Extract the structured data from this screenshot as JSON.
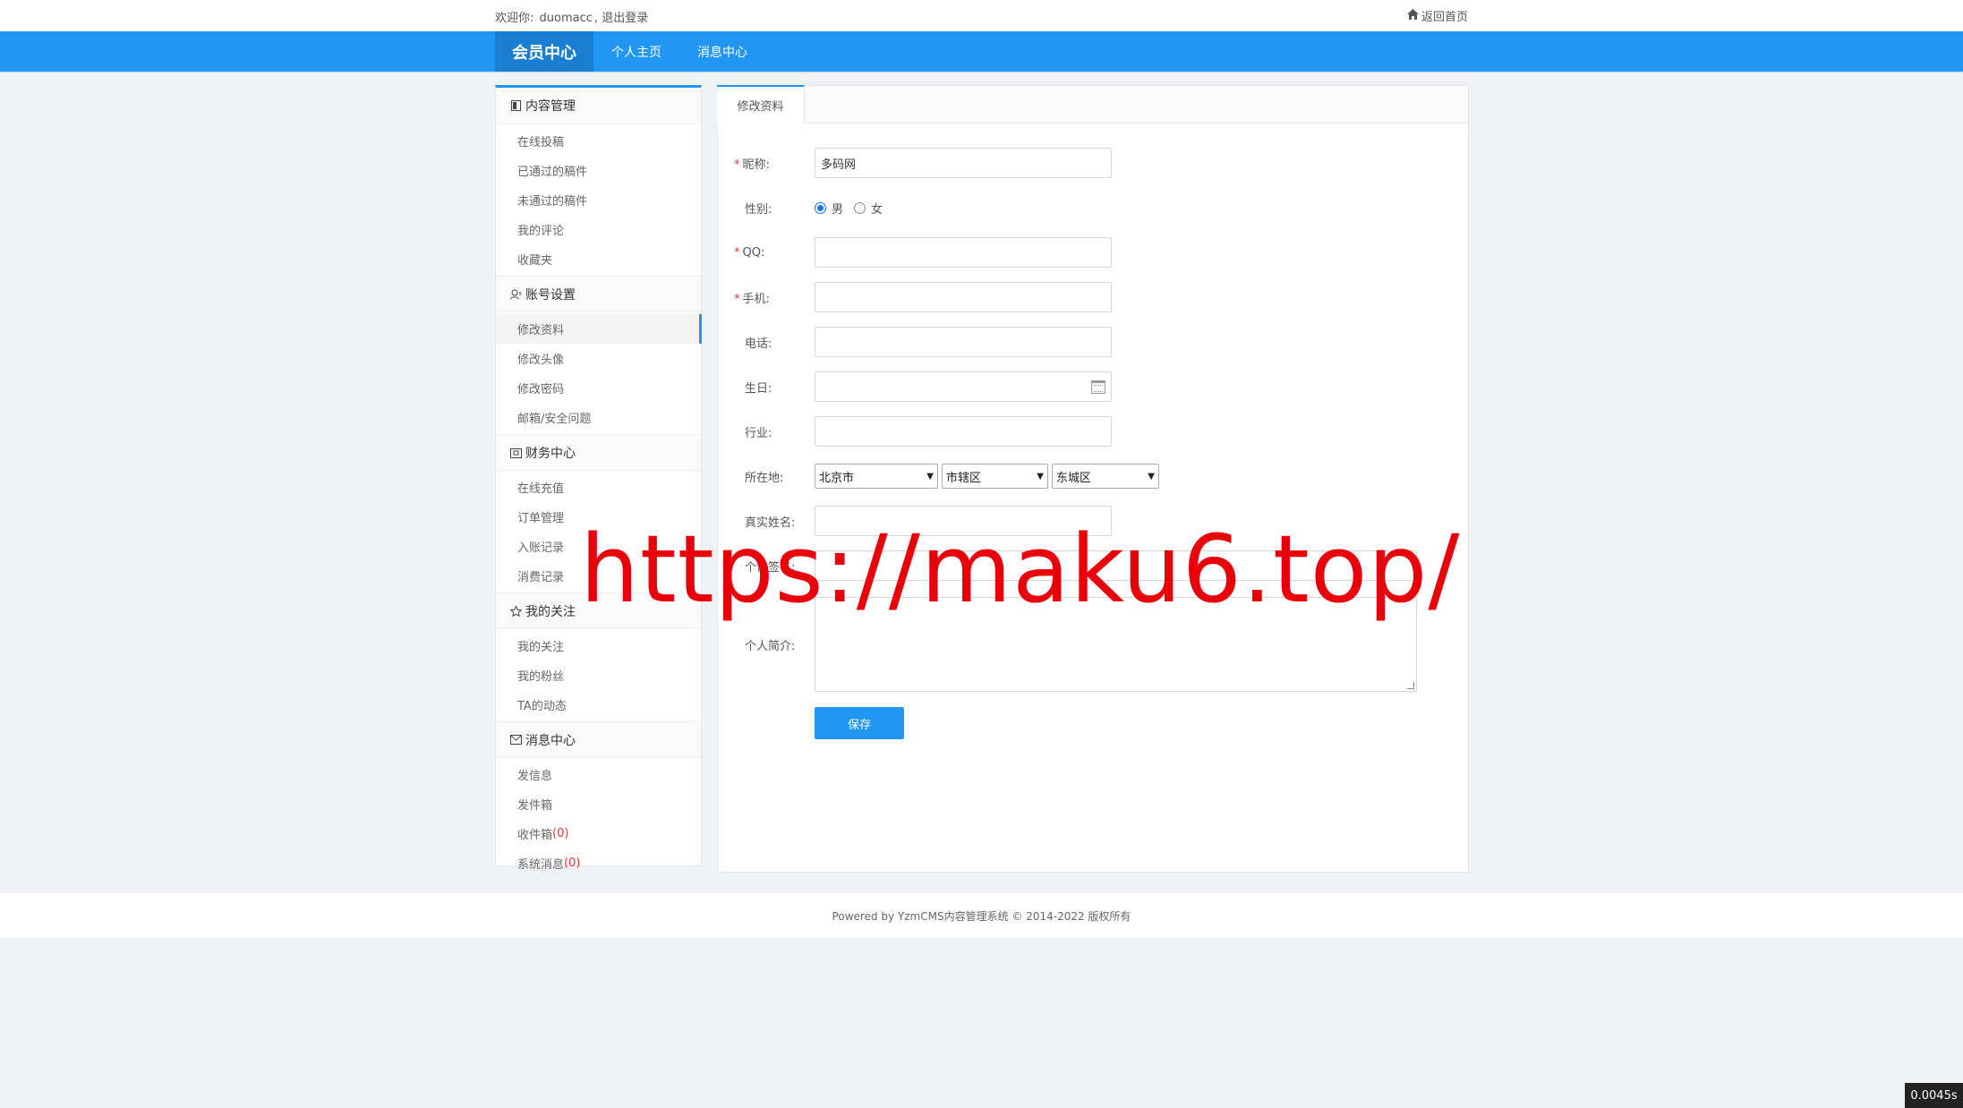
{
  "topbar": {
    "welcome_prefix": "欢迎你:",
    "username": "duomacc",
    "separator": ",",
    "logout": "退出登录",
    "home_link": "返回首页",
    "home_icon": "home-icon"
  },
  "navbar": {
    "brand": "会员中心",
    "items": [
      {
        "label": "个人主页"
      },
      {
        "label": "消息中心"
      }
    ]
  },
  "sidebar": {
    "groups": [
      {
        "title": "内容管理",
        "icon": "document-icon",
        "items": [
          "在线投稿",
          "已通过的稿件",
          "未通过的稿件",
          "我的评论",
          "收藏夹"
        ]
      },
      {
        "title": "账号设置",
        "icon": "user-icon",
        "items": [
          "修改资料",
          "修改头像",
          "修改密码",
          "邮箱/安全问题"
        ]
      },
      {
        "title": "财务中心",
        "icon": "wallet-icon",
        "items": [
          "在线充值",
          "订单管理",
          "入账记录",
          "消费记录"
        ]
      },
      {
        "title": "我的关注",
        "icon": "star-icon",
        "items": [
          "我的关注",
          "我的粉丝",
          "TA的动态"
        ]
      },
      {
        "title": "消息中心",
        "icon": "mail-icon",
        "items": [
          "发信息",
          "发件箱",
          "收件箱",
          "系统消息"
        ]
      }
    ],
    "active_item": "修改资料",
    "inbox_count": "(0)",
    "system_count": "(0)"
  },
  "main": {
    "tab": "修改资料",
    "fields": {
      "nickname": {
        "label": "昵称:",
        "value": "多码网",
        "required": true
      },
      "gender": {
        "label": "性别:",
        "options": [
          "男",
          "女"
        ],
        "selected": "男"
      },
      "qq": {
        "label": "QQ:",
        "value": "",
        "required": true
      },
      "mobile": {
        "label": "手机:",
        "value": "",
        "required": true
      },
      "phone": {
        "label": "电话:",
        "value": ""
      },
      "birthday": {
        "label": "生日:",
        "value": ""
      },
      "industry": {
        "label": "行业:",
        "value": ""
      },
      "location": {
        "label": "所在地:",
        "province": "北京市",
        "city": "市辖区",
        "district": "东城区"
      },
      "realname": {
        "label": "真实姓名:",
        "value": ""
      },
      "website": {
        "label": "个性签名:",
        "value": ""
      },
      "intro": {
        "label": "个人简介:",
        "value": ""
      }
    },
    "save": "保存"
  },
  "footer": {
    "text": "Powered by YzmCMS内容管理系统 © 2014-2022 版权所有"
  },
  "watermark": "https://maku6.top/",
  "timer": "0.0045s",
  "colors": {
    "accent": "#2196f3",
    "brand_bg": "#1a7ed3",
    "required": "#e33333",
    "watermark": "#e8000b"
  }
}
